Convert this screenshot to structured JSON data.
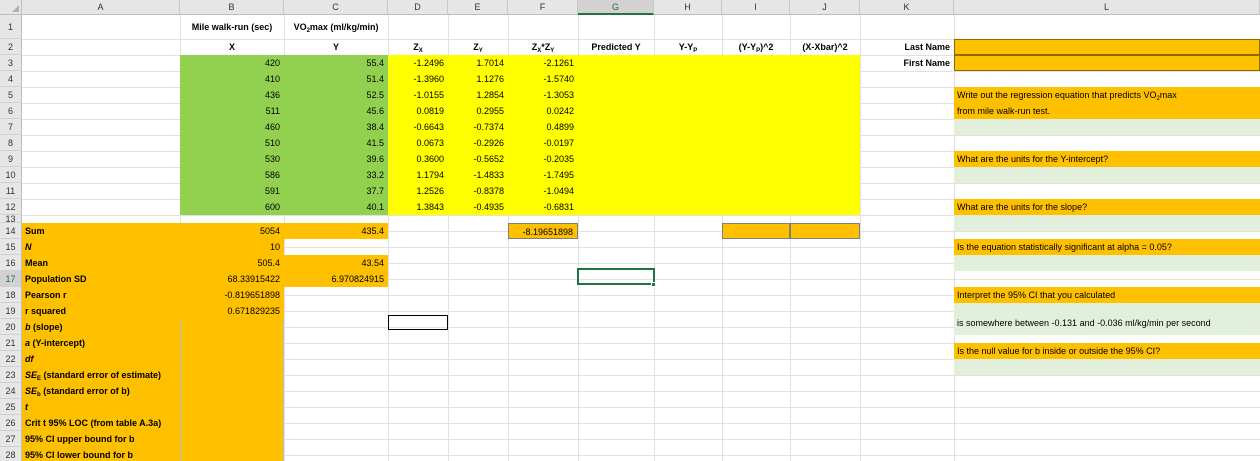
{
  "sheet": {
    "columns": [
      "A",
      "B",
      "C",
      "D",
      "E",
      "F",
      "G",
      "H",
      "I",
      "J",
      "K",
      "L"
    ],
    "rows": [
      "1",
      "2",
      "3",
      "4",
      "5",
      "6",
      "7",
      "8",
      "9",
      "10",
      "11",
      "12",
      "13",
      "14",
      "15",
      "16",
      "17",
      "18",
      "19",
      "20",
      "21",
      "22",
      "23",
      "24",
      "25",
      "26",
      "27",
      "28"
    ],
    "selected_column": "G",
    "selected_row": "17"
  },
  "headers": {
    "b1": "Mile walk-run (sec)",
    "c1_pre": "VO",
    "c1_sub": "2",
    "c1_post": "max (ml/kg/min)",
    "b2": "X",
    "c2": "Y",
    "d2_pre": "Z",
    "d2_sub": "X",
    "e2_pre": "Z",
    "e2_sub": "Y",
    "f2_a": "Z",
    "f2_sub1": "X",
    "f2_b": "*Z",
    "f2_sub2": "Y",
    "g2": "Predicted Y",
    "h2_pre": "Y-Y",
    "h2_sub": "P",
    "i2_pre": "(Y-Y",
    "i2_sub": "P",
    "i2_post": ")^2",
    "j2": "(X-Xbar)^2",
    "k2": "Last Name",
    "k3": "First Name"
  },
  "data_rows": [
    {
      "x": "420",
      "y": "55.4",
      "zx": "-1.2496",
      "zy": "1.7014",
      "zxzy": "-2.1261"
    },
    {
      "x": "410",
      "y": "51.4",
      "zx": "-1.3960",
      "zy": "1.1276",
      "zxzy": "-1.5740"
    },
    {
      "x": "436",
      "y": "52.5",
      "zx": "-1.0155",
      "zy": "1.2854",
      "zxzy": "-1.3053"
    },
    {
      "x": "511",
      "y": "45.6",
      "zx": "0.0819",
      "zy": "0.2955",
      "zxzy": "0.0242"
    },
    {
      "x": "460",
      "y": "38.4",
      "zx": "-0.6643",
      "zy": "-0.7374",
      "zxzy": "0.4899"
    },
    {
      "x": "510",
      "y": "41.5",
      "zx": "0.0673",
      "zy": "-0.2926",
      "zxzy": "-0.0197"
    },
    {
      "x": "530",
      "y": "39.6",
      "zx": "0.3600",
      "zy": "-0.5652",
      "zxzy": "-0.2035"
    },
    {
      "x": "586",
      "y": "33.2",
      "zx": "1.1794",
      "zy": "-1.4833",
      "zxzy": "-1.7495"
    },
    {
      "x": "591",
      "y": "37.7",
      "zx": "1.2526",
      "zy": "-0.8378",
      "zxzy": "-1.0494"
    },
    {
      "x": "600",
      "y": "40.1",
      "zx": "1.3843",
      "zy": "-0.4935",
      "zxzy": "-0.6831"
    }
  ],
  "stats_labels": {
    "a14": "Sum",
    "a15": "N",
    "a16": "Mean",
    "a17": "Population SD",
    "a18": "Pearson r",
    "a19": "r squared",
    "a20_b": "b",
    "a20_rest": " (slope)",
    "a21_a": "a",
    "a21_rest": " (Y-intercept)",
    "a22": "df",
    "a23_pre": "SE",
    "a23_sub": "E",
    "a23_post": " (standard error of estimate)",
    "a24_pre": "SE",
    "a24_sub": "b",
    "a24_post": " (standard error of b)",
    "a25": "t",
    "a26": "Crit t 95% LOC (from table A.3a)",
    "a27": "95% CI upper bound for b",
    "a28": "95% CI lower bound for b"
  },
  "stats_values": {
    "b14": "5054",
    "c14": "435.4",
    "f14": "-8.19651898",
    "b15": "10",
    "b16": "505.4",
    "c16": "43.54",
    "b17": "68.33915422",
    "c17": "6.970824915",
    "b18": "-0.819651898",
    "b19": "0.671829235"
  },
  "questions": {
    "q1a_pre": "Write out the regression equation that predicts VO",
    "q1a_sub": "2",
    "q1a_post": "max",
    "q1b": "from mile walk-run test.",
    "q2": "What are the units for the Y-intercept?",
    "q3": "What are the units for the slope?",
    "q4": "Is the equation statistically significant at alpha = 0.05?",
    "q5": "Interpret the 95% CI that you calculated",
    "q5_answer": "is somewhere between -0.131 and -0.036 ml/kg/min per second",
    "q6": "Is the null value for b inside or outside the 95% CI?"
  },
  "colors": {
    "green": "#92d050",
    "yellow": "#ffff00",
    "orange": "#ffc000",
    "light_green": "#e2efda",
    "selection": "#217346"
  }
}
